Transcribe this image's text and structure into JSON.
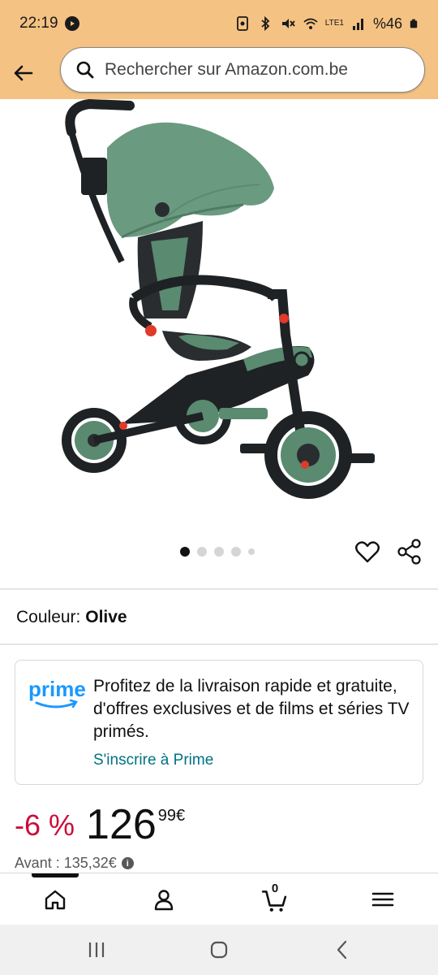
{
  "status_bar": {
    "time": "22:19",
    "battery": "%46",
    "network": "LTE1"
  },
  "search": {
    "placeholder": "Rechercher sur Amazon.com.be"
  },
  "product": {
    "image_alt": "green tricycle",
    "carousel_total": 5,
    "carousel_active": 1
  },
  "color": {
    "label": "Couleur:",
    "value": "Olive"
  },
  "prime": {
    "logo_text": "prime",
    "message": "Profitez de la livraison rapide et gratuite, d'offres exclusives et de films et séries TV primés.",
    "link": "S'inscrire à Prime"
  },
  "price": {
    "discount": "-6 %",
    "whole": "126",
    "fraction": "99",
    "currency": "€",
    "before_label": "Avant : 135,32€"
  },
  "bottom_nav": {
    "cart_count": "0",
    "items": [
      "home",
      "account",
      "cart",
      "menu"
    ]
  },
  "colors": {
    "header_bg": "#f4c283",
    "link": "#007185",
    "discount": "#cc0c39",
    "prime_blue": "#1a98ff"
  }
}
